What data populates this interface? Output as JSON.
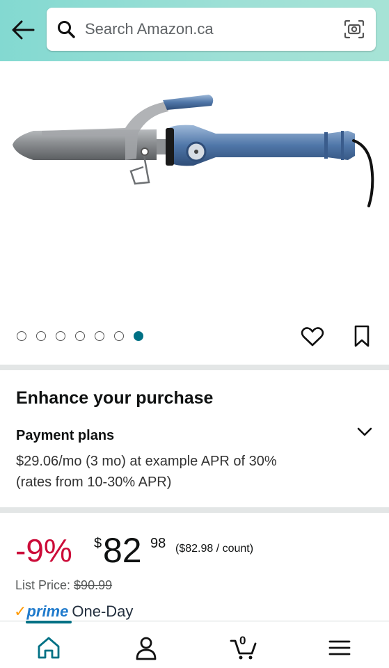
{
  "search": {
    "placeholder": "Search Amazon.ca"
  },
  "gallery": {
    "total_images": 7,
    "active_index": 6
  },
  "enhance": {
    "title": "Enhance your purchase",
    "payment_title": "Payment plans",
    "payment_text": "$29.06/mo (3 mo) at example APR of 30% (rates from 10-30% APR)"
  },
  "pricing": {
    "discount": "-9%",
    "currency": "$",
    "whole": "82",
    "fraction": "98",
    "unit_price": "($82.98 / count)",
    "list_price_label": "List Price:",
    "list_price": "$90.99"
  },
  "prime": {
    "check": "✓",
    "word": "prime",
    "label": "One-Day"
  },
  "cart": {
    "count": "0"
  },
  "colors": {
    "teal": "#007185",
    "discount_red": "#cc0c39",
    "prime_orange": "#ff9900",
    "prime_blue": "#1f7acc"
  }
}
